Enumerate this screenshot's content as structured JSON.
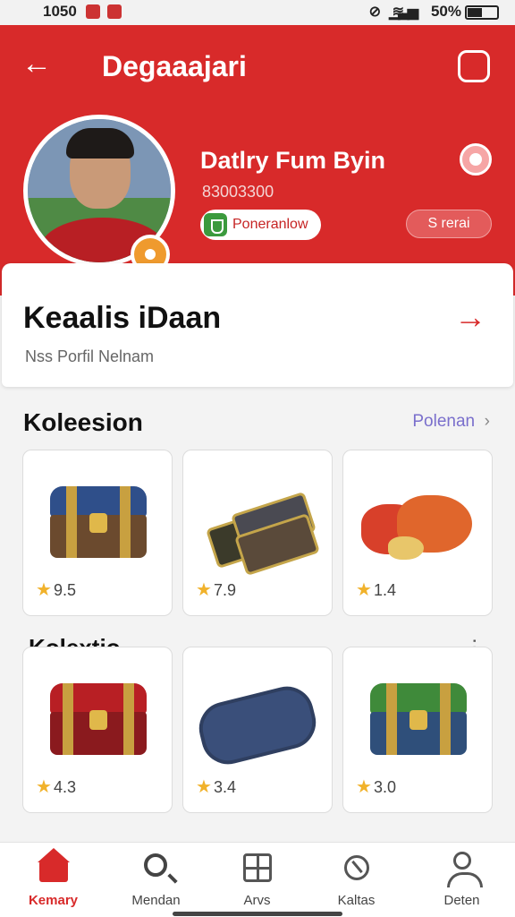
{
  "status_bar": {
    "time": "1050",
    "battery": "50%"
  },
  "header": {
    "title": "Degaaajari",
    "back_icon": "arrow-left-icon",
    "action_icon": "profile-settings-icon"
  },
  "profile": {
    "name": "Datlry Fum Byin",
    "user_id": "83003300",
    "status_label": "Poneranlow",
    "small_button": "S rerai",
    "card_title": "Keaalis iDaan",
    "card_subtitle": "Nss Porfil Nelnam"
  },
  "collection_1": {
    "title": "Koleesion",
    "link": "Polenan",
    "items": [
      {
        "name": "treasure-chest",
        "rating": "9.5"
      },
      {
        "name": "card-pack",
        "rating": "7.9"
      },
      {
        "name": "boxing-gloves",
        "rating": "1.4"
      }
    ]
  },
  "collection_2": {
    "title": "Kolextio",
    "items": [
      {
        "name": "red-chest",
        "rating": "4.3"
      },
      {
        "name": "pencil-pouch",
        "rating": "3.4"
      },
      {
        "name": "green-chest",
        "rating": "3.0"
      }
    ]
  },
  "bottom_nav": [
    {
      "label": "Kemary",
      "icon": "home-icon",
      "active": true
    },
    {
      "label": "Mendan",
      "icon": "search-icon",
      "active": false
    },
    {
      "label": "Arvs",
      "icon": "grid-icon",
      "active": false
    },
    {
      "label": "Kaltas",
      "icon": "tag-icon",
      "active": false
    },
    {
      "label": "Deten",
      "icon": "user-icon",
      "active": false
    }
  ],
  "colors": {
    "primary": "#d82a2a",
    "link": "#7a6fcc",
    "star": "#f1b22b"
  }
}
